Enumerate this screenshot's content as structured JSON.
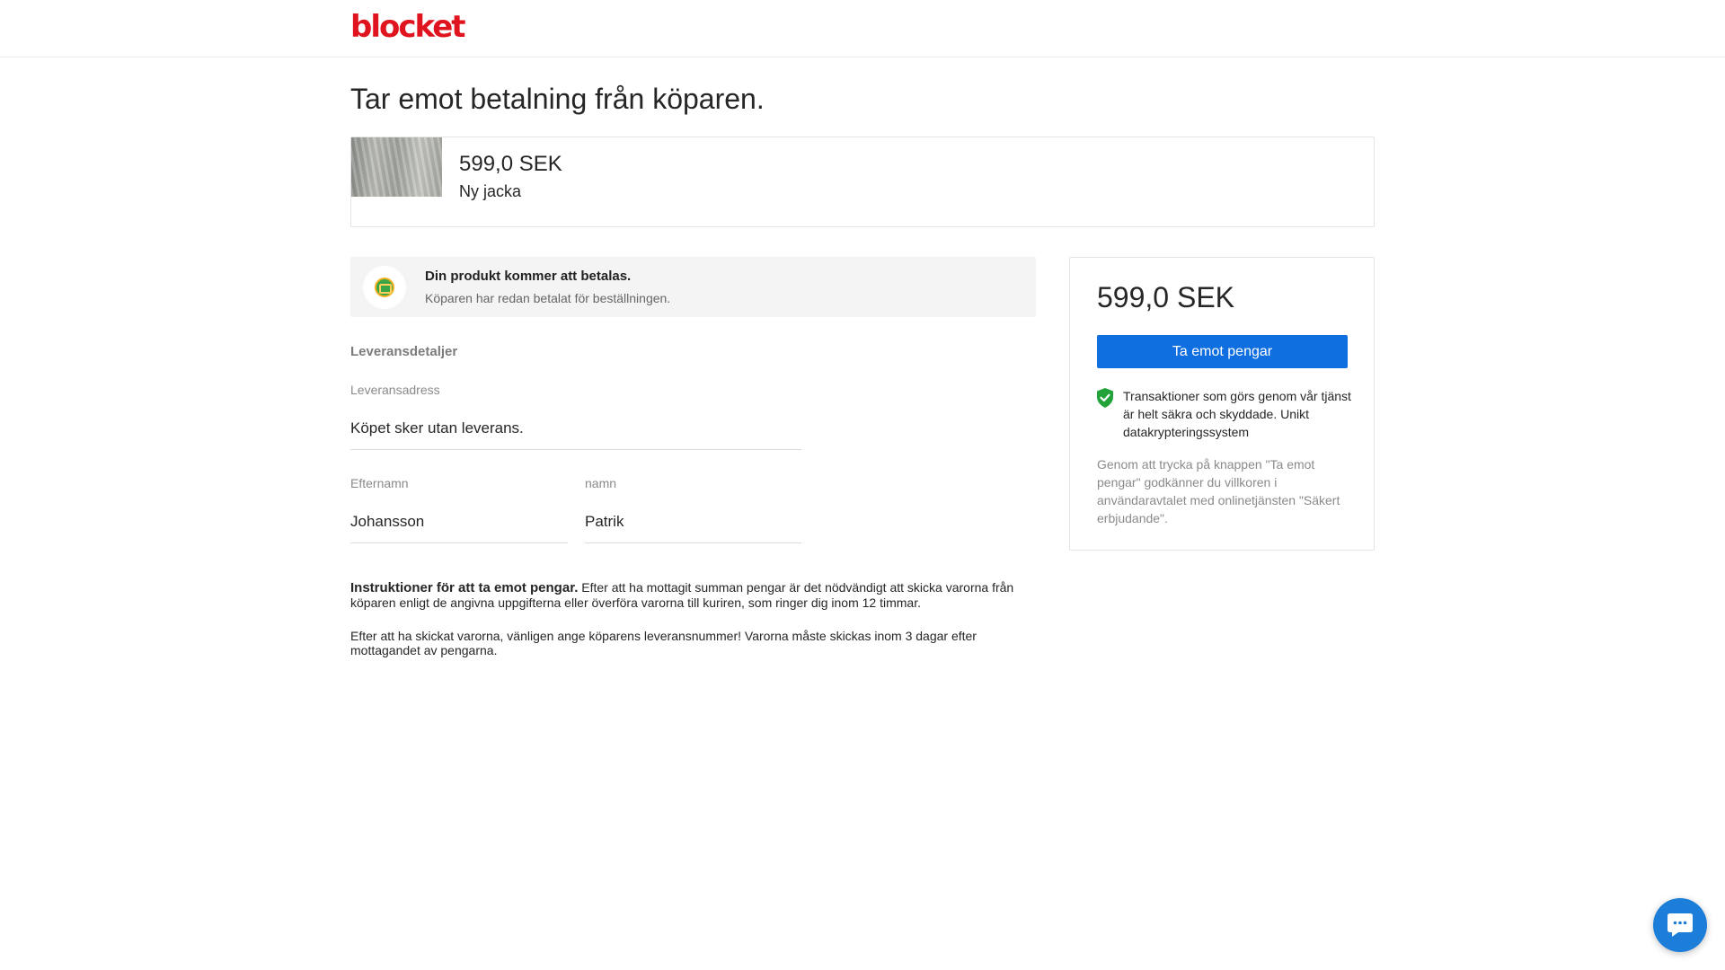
{
  "header": {
    "logo_text": "blocket"
  },
  "page": {
    "title": "Tar emot betalning från köparen."
  },
  "product": {
    "price": "599,0 SEK",
    "name": "Ny jacka"
  },
  "notice": {
    "title": "Din produkt kommer att betalas.",
    "text": "Köparen har redan betalat för beställningen."
  },
  "delivery": {
    "section_title": "Leveransdetaljer",
    "address_label": "Leveransadress",
    "address_value": "Köpet sker utan leverans.",
    "last_name_label": "Efternamn",
    "last_name_value": "Johansson",
    "first_name_label": "namn",
    "first_name_value": "Patrik"
  },
  "instructions": {
    "bold_lead": "Instruktioner för att ta emot pengar.",
    "para1_rest": " Efter att ha mottagit summan pengar är det nödvändigt att skicka varorna från köparen enligt de angivna uppgifterna eller överföra varorna till kuriren, som ringer dig inom 12 timmar.",
    "para2": "Efter att ha skickat varorna, vänligen ange köparens leveransnummer! Varorna måste skickas inom 3 dagar efter mottagandet av pengarna."
  },
  "payment": {
    "price": "599,0 SEK",
    "button_label": "Ta emot pengar",
    "secure_text": "Transaktioner som görs genom vår tjänst är helt säkra och skyddade. Unikt datakrypteringssystem",
    "terms_text": "Genom att trycka på knappen \"Ta emot pengar\" godkänner du villkoren i användaravtalet med onlinetjänsten \"Säkert erbjudande\"."
  },
  "colors": {
    "brand": "#e0141e",
    "primary_button": "#0f6fe0",
    "shield": "#22a33a",
    "chat": "#1c7ed9"
  },
  "icons": {
    "notice": "payment-coin-icon",
    "secure": "shield-check-icon",
    "chat": "chat-bubble-icon"
  }
}
